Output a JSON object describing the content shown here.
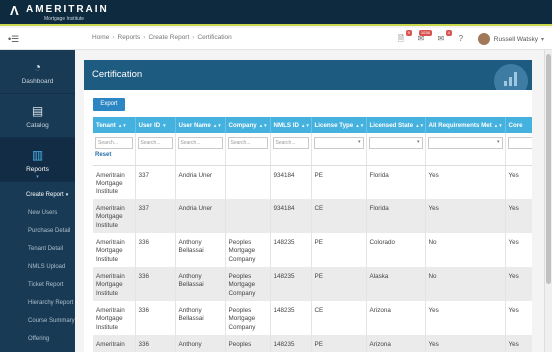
{
  "brand": {
    "name": "AMERITRAIN",
    "tagline": "Mortgage Institute"
  },
  "header": {
    "breadcrumb": [
      "Home",
      "Reports",
      "Create Report",
      "Certification"
    ],
    "notifications": [
      {
        "icon": "alert-icon",
        "badge": "9"
      },
      {
        "icon": "bell-icon",
        "badge": "1036"
      },
      {
        "icon": "envelope-icon",
        "badge": "4"
      },
      {
        "icon": "help-icon",
        "badge": ""
      }
    ],
    "user": {
      "name": "Russell Watsky"
    }
  },
  "sidebar": {
    "items": [
      {
        "label": "Dashboard",
        "icon": "dashboard-icon"
      },
      {
        "label": "Catalog",
        "icon": "catalog-icon"
      },
      {
        "label": "Reports",
        "icon": "reports-icon"
      }
    ],
    "submenu_current": "Create Report",
    "submenu": [
      "New Users",
      "Purchase Detail",
      "Tenant Detail",
      "NMLS Upload",
      "Ticket Report",
      "Hierarchy Report",
      "Course Summary",
      "Offering"
    ]
  },
  "page": {
    "title": "Certification",
    "export_label": "Export",
    "reset_label": "Reset"
  },
  "table": {
    "columns": [
      "Tenant",
      "User ID",
      "User Name",
      "Company",
      "NMLS ID",
      "License Type",
      "Licensed State",
      "All Requirements Met",
      "Core"
    ],
    "filter_placeholder": "Search...",
    "rows": [
      [
        "Ameritrain Mortgage Institute",
        "337",
        "Andria Uner",
        "",
        "934184",
        "PE",
        "Florida",
        "Yes",
        "Yes"
      ],
      [
        "Ameritrain Mortgage Institute",
        "337",
        "Andria Uner",
        "",
        "934184",
        "CE",
        "Florida",
        "Yes",
        "Yes"
      ],
      [
        "Ameritrain Mortgage Institute",
        "336",
        "Anthony Bellassai",
        "Peoples Mortgage Company",
        "148235",
        "PE",
        "Colorado",
        "No",
        "Yes"
      ],
      [
        "Ameritrain Mortgage Institute",
        "336",
        "Anthony Bellassai",
        "Peoples Mortgage Company",
        "148235",
        "PE",
        "Alaska",
        "No",
        "Yes"
      ],
      [
        "Ameritrain Mortgage Institute",
        "336",
        "Anthony Bellassai",
        "Peoples Mortgage Company",
        "148235",
        "CE",
        "Arizona",
        "Yes",
        "Yes"
      ],
      [
        "Ameritrain",
        "336",
        "Anthony",
        "Peoples",
        "148235",
        "PE",
        "Arizona",
        "Yes",
        "Yes"
      ]
    ]
  },
  "colors": {
    "brand_bar": "#0e2a3e",
    "accent_line": "#c7d64a",
    "sidebar": "#183a55",
    "card_header": "#1e5b80",
    "table_header": "#45b1de",
    "button": "#2c86c4"
  }
}
